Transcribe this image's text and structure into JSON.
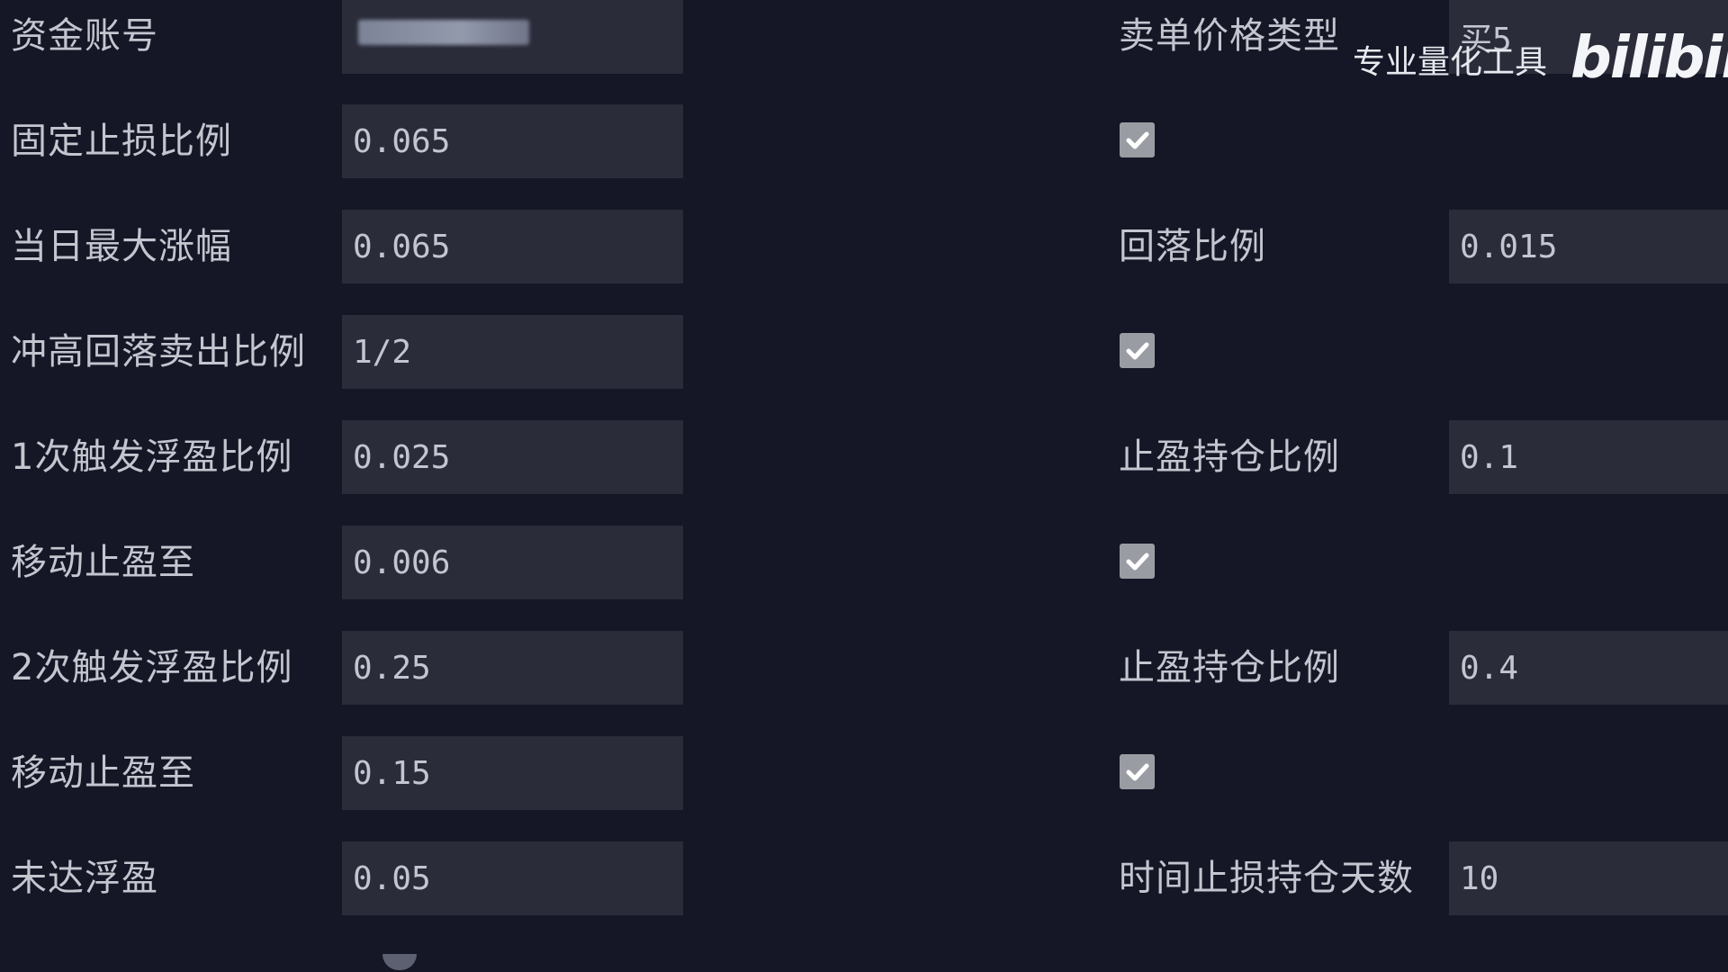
{
  "left_column": {
    "rows": [
      {
        "label": "资金账号",
        "value": ""
      },
      {
        "label": "固定止损比例",
        "value": "0.065"
      },
      {
        "label": "当日最大涨幅",
        "value": "0.065"
      },
      {
        "label": "冲高回落卖出比例",
        "value": "1/2"
      },
      {
        "label": "1次触发浮盈比例",
        "value": "0.025"
      },
      {
        "label": "移动止盈至",
        "value": "0.006"
      },
      {
        "label": "2次触发浮盈比例",
        "value": "0.25"
      },
      {
        "label": "移动止盈至",
        "value": "0.15"
      },
      {
        "label": "未达浮盈",
        "value": "0.05"
      }
    ]
  },
  "right_column": {
    "sell_price_type": {
      "label": "卖单价格类型",
      "value": "买5"
    },
    "checkbox_1": {
      "checked": true
    },
    "pullback_ratio": {
      "label": "回落比例",
      "value": "0.015"
    },
    "checkbox_2": {
      "checked": true
    },
    "take_profit_position_ratio_1": {
      "label": "止盈持仓比例",
      "value": "0.1"
    },
    "checkbox_3": {
      "checked": true
    },
    "take_profit_position_ratio_2": {
      "label": "止盈持仓比例",
      "value": "0.4"
    },
    "checkbox_4": {
      "checked": true
    },
    "time_stop_days": {
      "label": "时间止损持仓天数",
      "value": "10"
    }
  },
  "watermark": {
    "text": "专业量化工具",
    "logo": "bilibili"
  },
  "colors": {
    "background": "#151726",
    "field_background": "#2a2c3a",
    "text": "#c3c6cf",
    "checkbox": "#9a9ca4"
  }
}
